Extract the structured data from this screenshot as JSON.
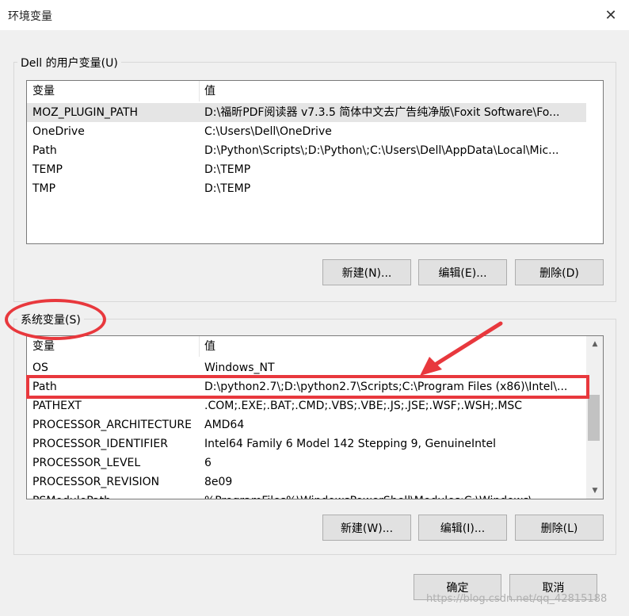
{
  "window": {
    "title": "环境变量",
    "close_icon": "close-icon"
  },
  "user_group": {
    "label": "Dell 的用户变量(U)",
    "columns": [
      "变量",
      "值"
    ],
    "rows": [
      {
        "name": "MOZ_PLUGIN_PATH",
        "value": "D:\\福昕PDF阅读器 v7.3.5 简体中文去广告纯净版\\Foxit Software\\Fo..."
      },
      {
        "name": "OneDrive",
        "value": "C:\\Users\\Dell\\OneDrive"
      },
      {
        "name": "Path",
        "value": "D:\\Python\\Scripts\\;D:\\Python\\;C:\\Users\\Dell\\AppData\\Local\\Mic..."
      },
      {
        "name": "TEMP",
        "value": "D:\\TEMP"
      },
      {
        "name": "TMP",
        "value": "D:\\TEMP"
      }
    ],
    "buttons": {
      "new": "新建(N)...",
      "edit": "编辑(E)...",
      "delete": "删除(D)"
    }
  },
  "system_group": {
    "label": "系统变量(S)",
    "columns": [
      "变量",
      "值"
    ],
    "rows": [
      {
        "name": "OS",
        "value": "Windows_NT"
      },
      {
        "name": "Path",
        "value": "D:\\python2.7\\;D:\\python2.7\\Scripts;C:\\Program Files (x86)\\Intel\\..."
      },
      {
        "name": "PATHEXT",
        "value": ".COM;.EXE;.BAT;.CMD;.VBS;.VBE;.JS;.JSE;.WSF;.WSH;.MSC"
      },
      {
        "name": "PROCESSOR_ARCHITECTURE",
        "value": "AMD64"
      },
      {
        "name": "PROCESSOR_IDENTIFIER",
        "value": "Intel64 Family 6 Model 142 Stepping 9, GenuineIntel"
      },
      {
        "name": "PROCESSOR_LEVEL",
        "value": "6"
      },
      {
        "name": "PROCESSOR_REVISION",
        "value": "8e09"
      },
      {
        "name": "PSModulePath",
        "value": "%ProgramFiles%\\WindowsPowerShell\\Modules;C:\\Windows\\..."
      }
    ],
    "buttons": {
      "new": "新建(W)...",
      "edit": "编辑(I)...",
      "delete": "删除(L)"
    }
  },
  "footer": {
    "ok": "确定",
    "cancel": "取消"
  },
  "watermark": "https://blog.csdn.net/qq_42815188",
  "annotation_color": "#e8383d"
}
